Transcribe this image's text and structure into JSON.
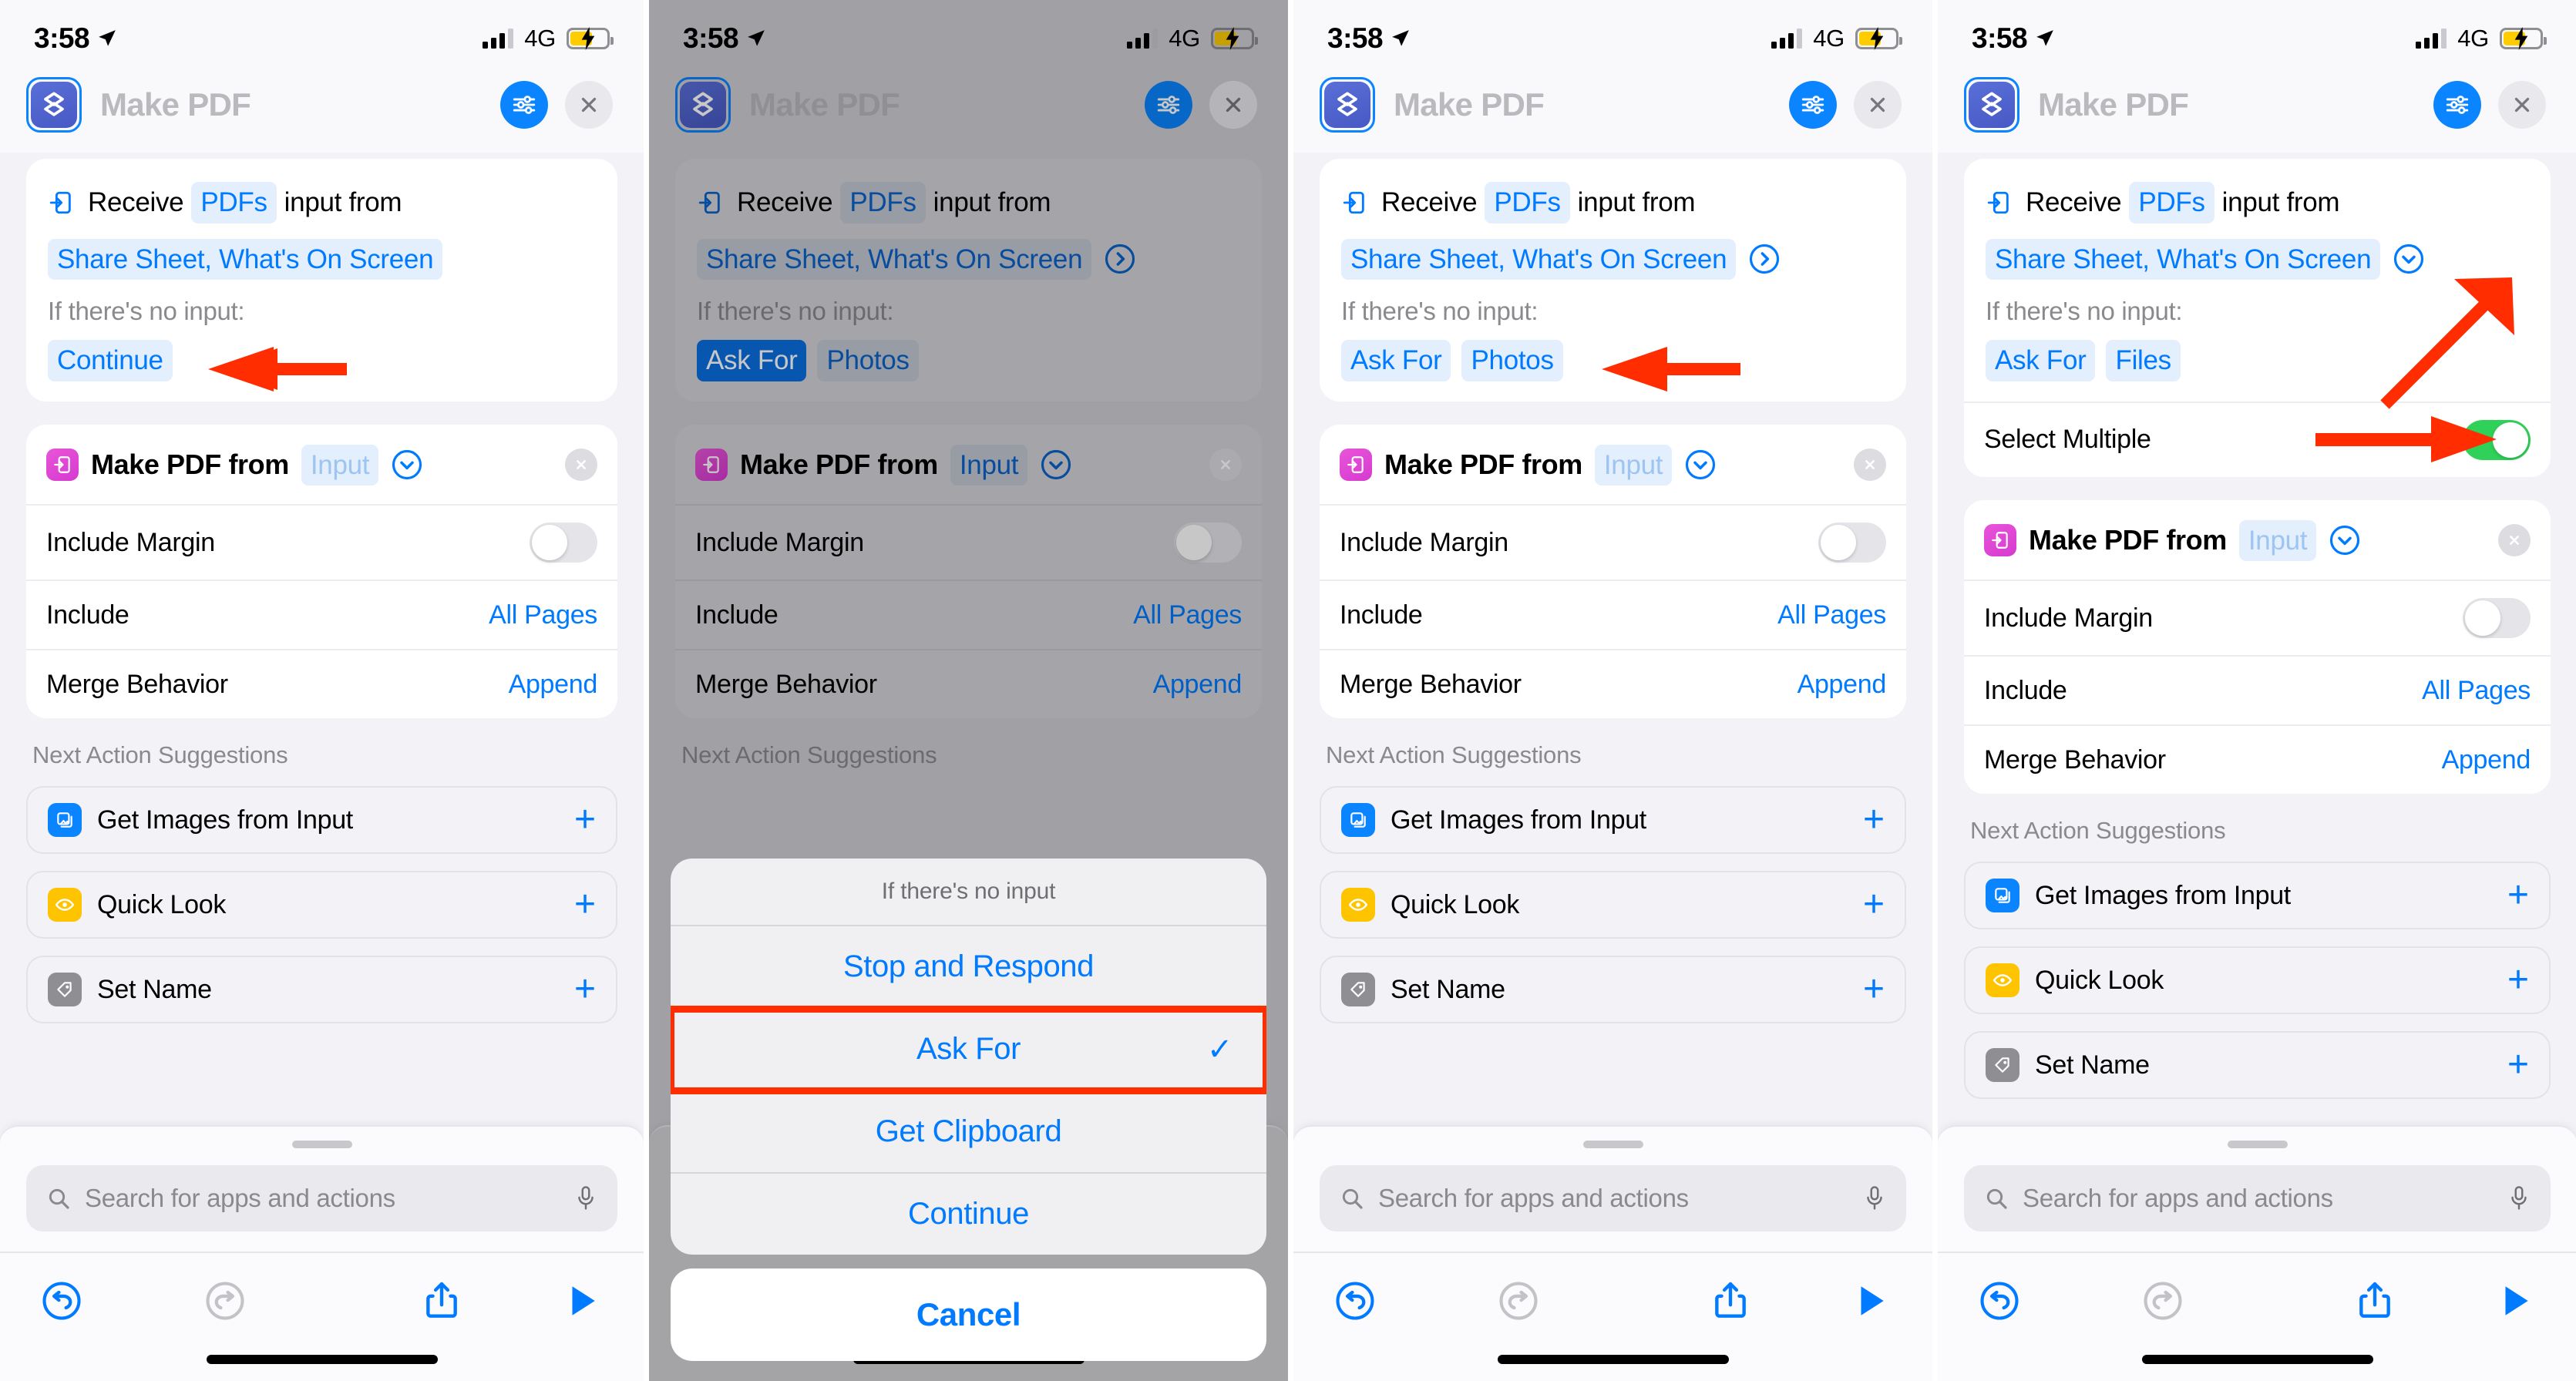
{
  "status_bar": {
    "time": "3:58",
    "location_icon": "location-arrow-icon",
    "signal_icon": "cellular-bars-icon",
    "network": "4G",
    "battery_icon": "battery-charging-low-power-icon"
  },
  "header": {
    "app_icon": "shortcuts-stack-icon",
    "title": "Make PDF",
    "settings_label": "settings-sliders-icon",
    "close_label": "close-x-icon"
  },
  "trigger_card": {
    "icon": "receive-input-icon",
    "receive_word": "Receive",
    "type_token": "PDFs",
    "input_from_word": "input from",
    "source_token": "Share Sheet, What's On Screen",
    "chevron_right_icon": "chevron-right-circle-icon",
    "chevron_down_icon": "chevron-down-circle-icon",
    "no_input_label": "If there's no input:",
    "fallback_continue": "Continue",
    "fallback_ask_for": "Ask For",
    "fallback_photos": "Photos",
    "fallback_files": "Files",
    "select_multiple_label": "Select Multiple",
    "select_multiple_on": true
  },
  "action_card": {
    "icon": "make-pdf-icon",
    "title": "Make PDF from",
    "input_token": "Input",
    "chevron_icon": "chevron-down-circle-icon",
    "remove_icon": "remove-x-icon",
    "rows": [
      {
        "label": "Include Margin",
        "control": "toggle",
        "value": "off"
      },
      {
        "label": "Include",
        "control": "value",
        "value": "All Pages"
      },
      {
        "label": "Merge Behavior",
        "control": "value",
        "value": "Append"
      }
    ]
  },
  "suggestions": {
    "title": "Next Action Suggestions",
    "items": [
      {
        "label": "Get Images from Input",
        "icon": "photos-stack-icon",
        "color": "#0a84ff",
        "add": "+"
      },
      {
        "label": "Quick Look",
        "icon": "quick-look-eye-icon",
        "color": "#ffc400",
        "add": "+"
      },
      {
        "label": "Set Name",
        "icon": "tag-icon",
        "color": "#8e8e93",
        "add": "+"
      }
    ]
  },
  "bottom_bar": {
    "search_placeholder": "Search for apps and actions",
    "search_icon": "search-icon",
    "mic_icon": "microphone-icon",
    "undo_icon": "undo-icon",
    "redo_icon": "redo-icon",
    "share_icon": "share-icon",
    "play_icon": "play-icon"
  },
  "action_sheet": {
    "header": "If there's no input",
    "options": [
      {
        "label": "Stop and Respond",
        "selected": false
      },
      {
        "label": "Ask For",
        "selected": true,
        "check": "✓"
      },
      {
        "label": "Get Clipboard",
        "selected": false
      },
      {
        "label": "Continue",
        "selected": false
      }
    ],
    "cancel": "Cancel"
  },
  "colors": {
    "accent_blue": "#007aff",
    "toggle_green": "#30d158",
    "annotation_red": "#ff2d00",
    "panel_bg": "#f2f2f7",
    "pdf_icon_pink": "#e855d8"
  }
}
